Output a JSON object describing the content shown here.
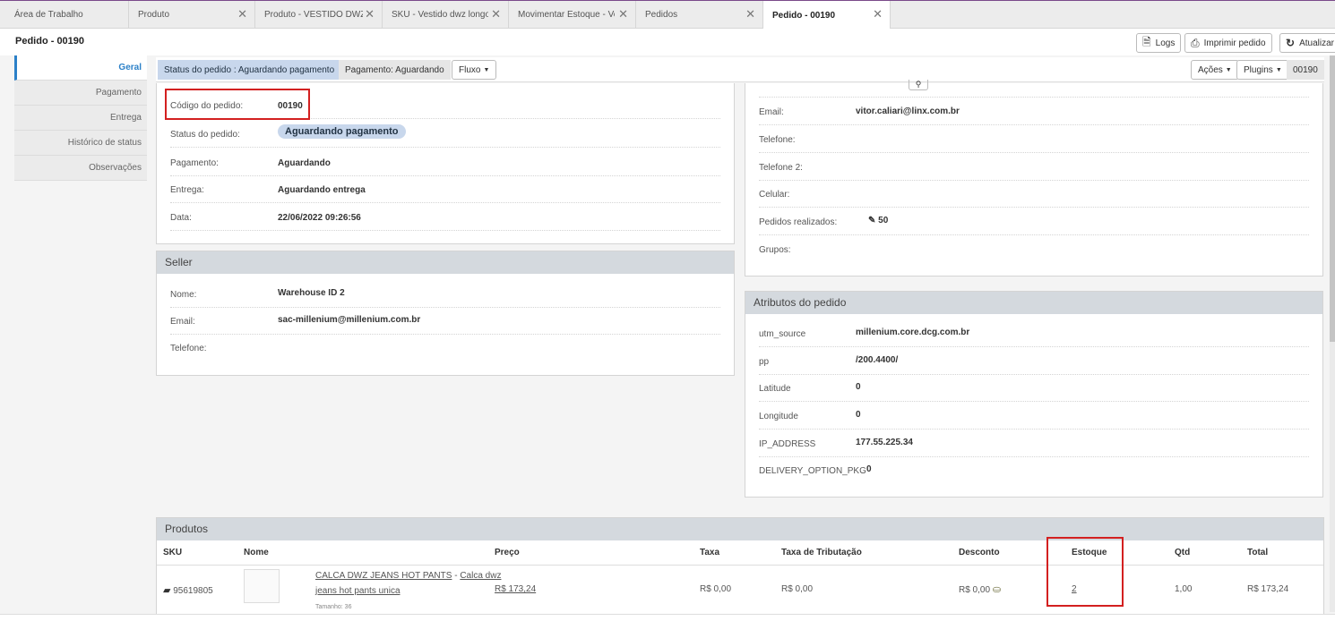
{
  "tabs": [
    {
      "label": "Área de Trabalho"
    },
    {
      "label": "Produto"
    },
    {
      "label": "Produto - VESTIDO DWZ L"
    },
    {
      "label": "SKU - Vestido dwz longo l"
    },
    {
      "label": "Movimentar Estoque - Ve"
    },
    {
      "label": "Pedidos"
    },
    {
      "label": "Pedido - 00190"
    }
  ],
  "header": {
    "title": "Pedido - 00190",
    "logs": "Logs",
    "print": "Imprimir pedido",
    "refresh": "Atualizar"
  },
  "nav": [
    "Geral",
    "Pagamento",
    "Entrega",
    "Histórico de status",
    "Observações"
  ],
  "statusbar": {
    "status": "Status do pedido : Aguardando pagamento",
    "payment": "Pagamento: Aguardando",
    "flow": "Fluxo",
    "actions": "Ações",
    "plugins": "Plugins",
    "order_code": "00190"
  },
  "order": {
    "code_label": "Código do pedido:",
    "code_value": "00190",
    "status_label": "Status do pedido:",
    "status_value": "Aguardando pagamento",
    "payment_label": "Pagamento:",
    "payment_value": "Aguardando",
    "delivery_label": "Entrega:",
    "delivery_value": "Aguardando entrega",
    "date_label": "Data:",
    "date_value": "22/06/2022 09:26:56"
  },
  "seller": {
    "title": "Seller",
    "name_label": "Nome:",
    "name_value": "Warehouse ID 2",
    "email_label": "Email:",
    "email_value": "sac-millenium@millenium.com.br",
    "phone_label": "Telefone:"
  },
  "customer": {
    "email_label": "Email:",
    "email_value": "vitor.caliari@linx.com.br",
    "phone_label": "Telefone:",
    "phone2_label": "Telefone 2:",
    "cell_label": "Celular:",
    "orders_label": "Pedidos realizados:",
    "orders_value": "50",
    "groups_label": "Grupos:"
  },
  "attributes": {
    "title": "Atributos do pedido",
    "rows": [
      {
        "key": "utm_source",
        "value": "millenium.core.dcg.com.br"
      },
      {
        "key": "pp",
        "value": "/200.4400/"
      },
      {
        "key": "Latitude",
        "value": "0"
      },
      {
        "key": "Longitude",
        "value": "0"
      },
      {
        "key": "IP_ADDRESS",
        "value": "177.55.225.34"
      },
      {
        "key": "DELIVERY_OPTION_PKG",
        "value": "0"
      }
    ]
  },
  "products": {
    "title": "Produtos",
    "headers": {
      "sku": "SKU",
      "name": "Nome",
      "price": "Preço",
      "tax": "Taxa",
      "taxation": "Taxa de Tributação",
      "discount": "Desconto",
      "stock": "Estoque",
      "qty": "Qtd",
      "total": "Total"
    },
    "row": {
      "sku": "95619805",
      "name_link": "CALCA DWZ JEANS HOT PANTS",
      "name_sep": " - ",
      "name_link2a": "Calca dwz",
      "name_link2b": "jeans hot pants unica",
      "size": "Tamanho: 36",
      "price": "R$ 173,24",
      "tax": "R$ 0,00",
      "taxation": "R$ 0,00",
      "discount": "R$ 0,00",
      "stock": "2",
      "qty": "1,00",
      "total": "R$ 173,24"
    }
  },
  "colors": {
    "accent": "#2b80c8",
    "highlight": "#d32020",
    "badge": "#c8d7ec"
  }
}
